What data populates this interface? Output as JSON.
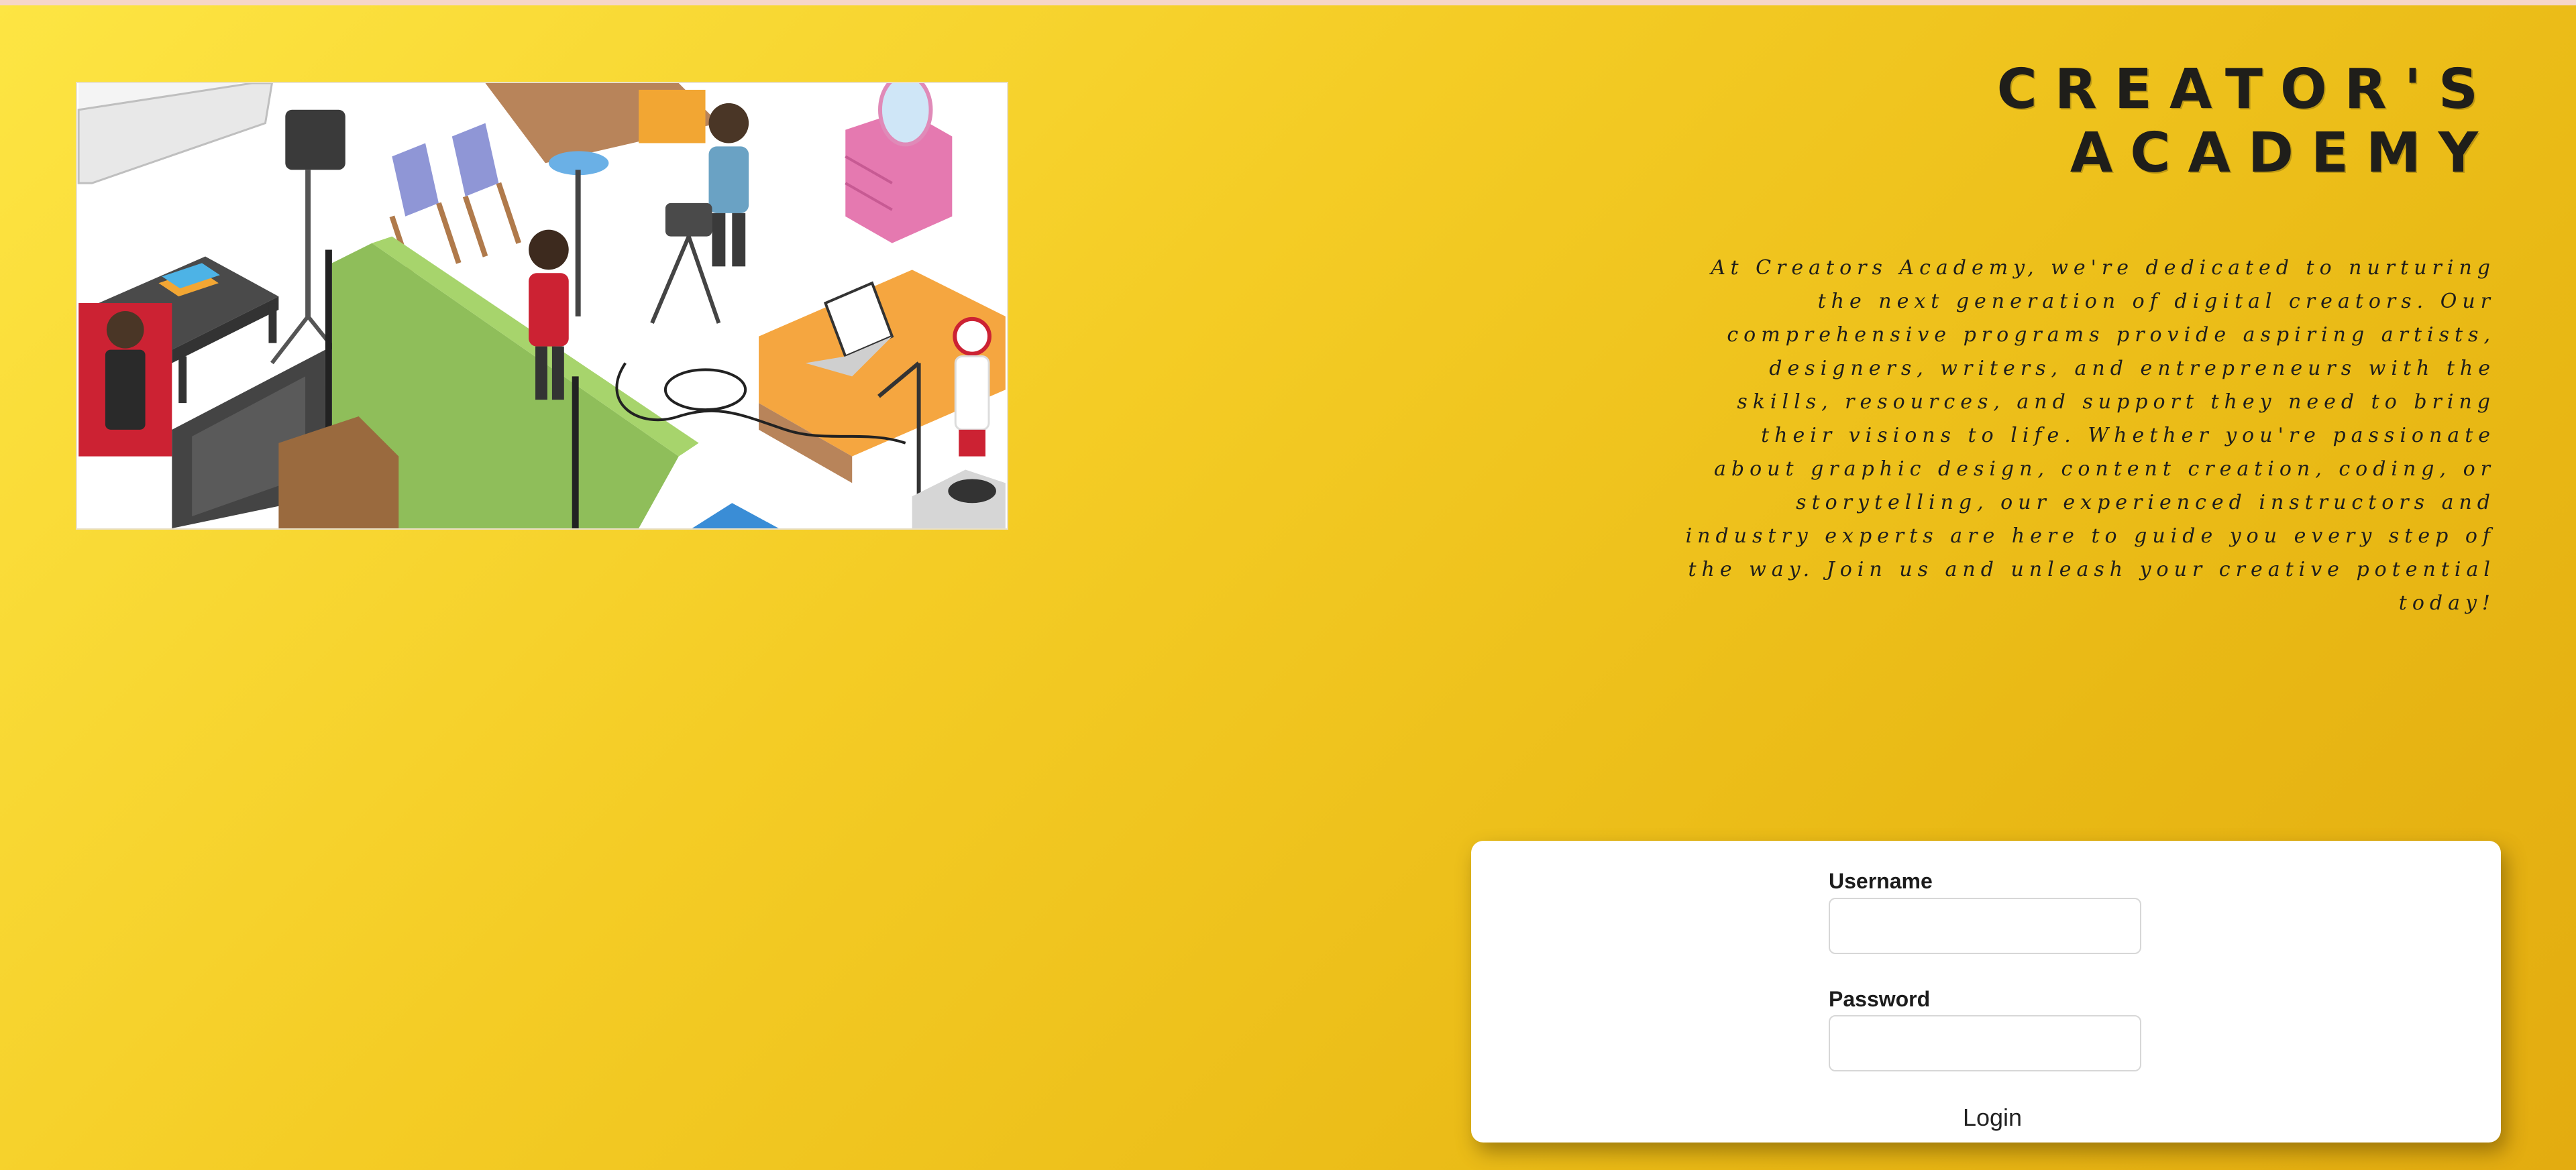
{
  "header": {
    "title": "CREATOR'S ACADEMY"
  },
  "intro": {
    "text": "At Creators Academy, we're dedicated to nurturing the next generation of digital creators. Our comprehensive programs provide aspiring artists, designers, writers, and entrepreneurs with the skills, resources, and support they need to bring their visions to life. Whether you're passionate about graphic design, content creation, coding, or storytelling, our experienced instructors and industry experts are here to guide you every step of the way. Join us and unleash your creative potential today!"
  },
  "login": {
    "username_label": "Username",
    "username_value": "",
    "password_label": "Password",
    "password_value": "",
    "button_label": "Login"
  },
  "colors": {
    "background_start": "#fde543",
    "background_end": "#e3ac10",
    "card": "#ffffff",
    "text": "#1f1e1a"
  }
}
